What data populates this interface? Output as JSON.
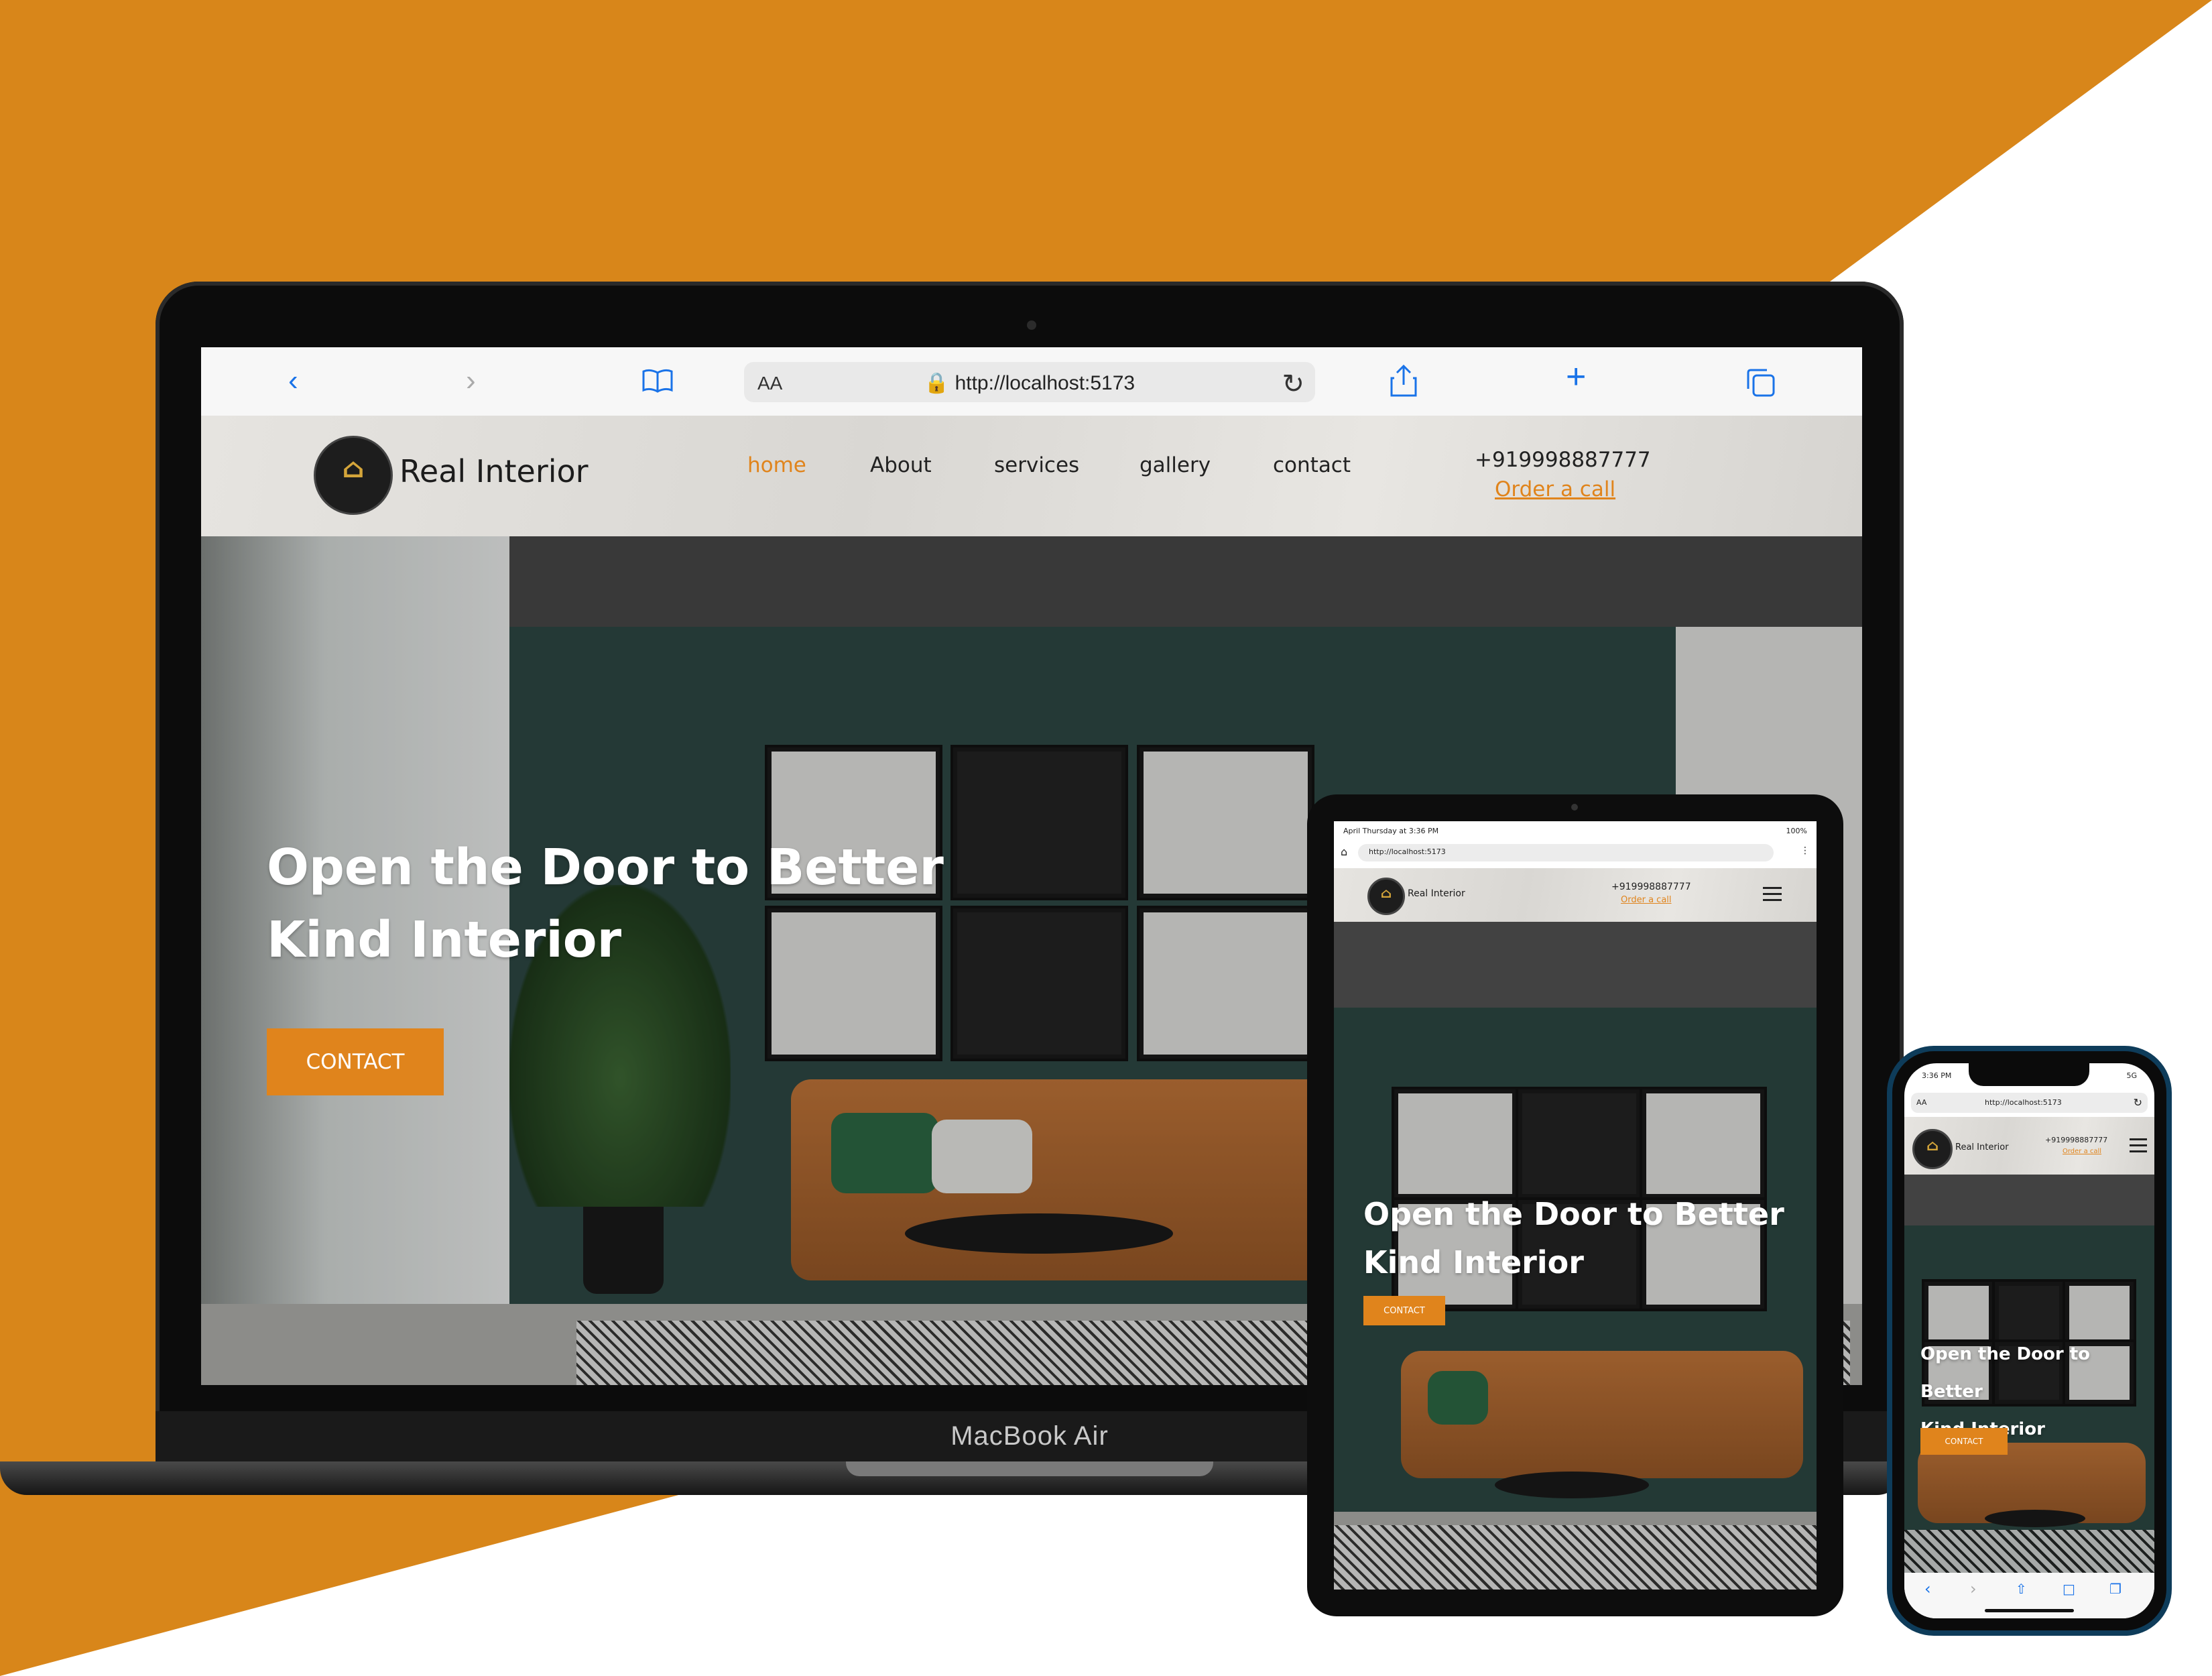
{
  "colors": {
    "accent": "#e0841c",
    "background_orange": "#d8861a",
    "background_white": "#ffffff"
  },
  "site": {
    "title": "Real Interior",
    "logo_text": "Real Interior",
    "nav": [
      {
        "label": "home",
        "active": true
      },
      {
        "label": "About",
        "active": false
      },
      {
        "label": "services",
        "active": false
      },
      {
        "label": "gallery",
        "active": false
      },
      {
        "label": "contact",
        "active": false
      }
    ],
    "phone": "+919998887777",
    "order_call": "Order a call",
    "hero_line1": "Open the Door to Better",
    "hero_line2": "Kind Interior",
    "contact_button": "CONTACT"
  },
  "laptop": {
    "brand": "MacBook Air",
    "browser": {
      "aa": "AA",
      "url": "http://localhost:5173",
      "icons": [
        "back-icon",
        "forward-icon",
        "bookmarks-icon",
        "lock-icon",
        "reload-icon",
        "share-icon",
        "new-tab-icon",
        "tabs-icon"
      ]
    }
  },
  "tablet": {
    "status_left": "April Thursday at 3:36 PM",
    "status_right": "100%",
    "url": "http://localhost:5173"
  },
  "phone": {
    "status_time": "3:36 PM",
    "status_right": "5G",
    "aa": "AA",
    "url": "http://localhost:5173"
  }
}
